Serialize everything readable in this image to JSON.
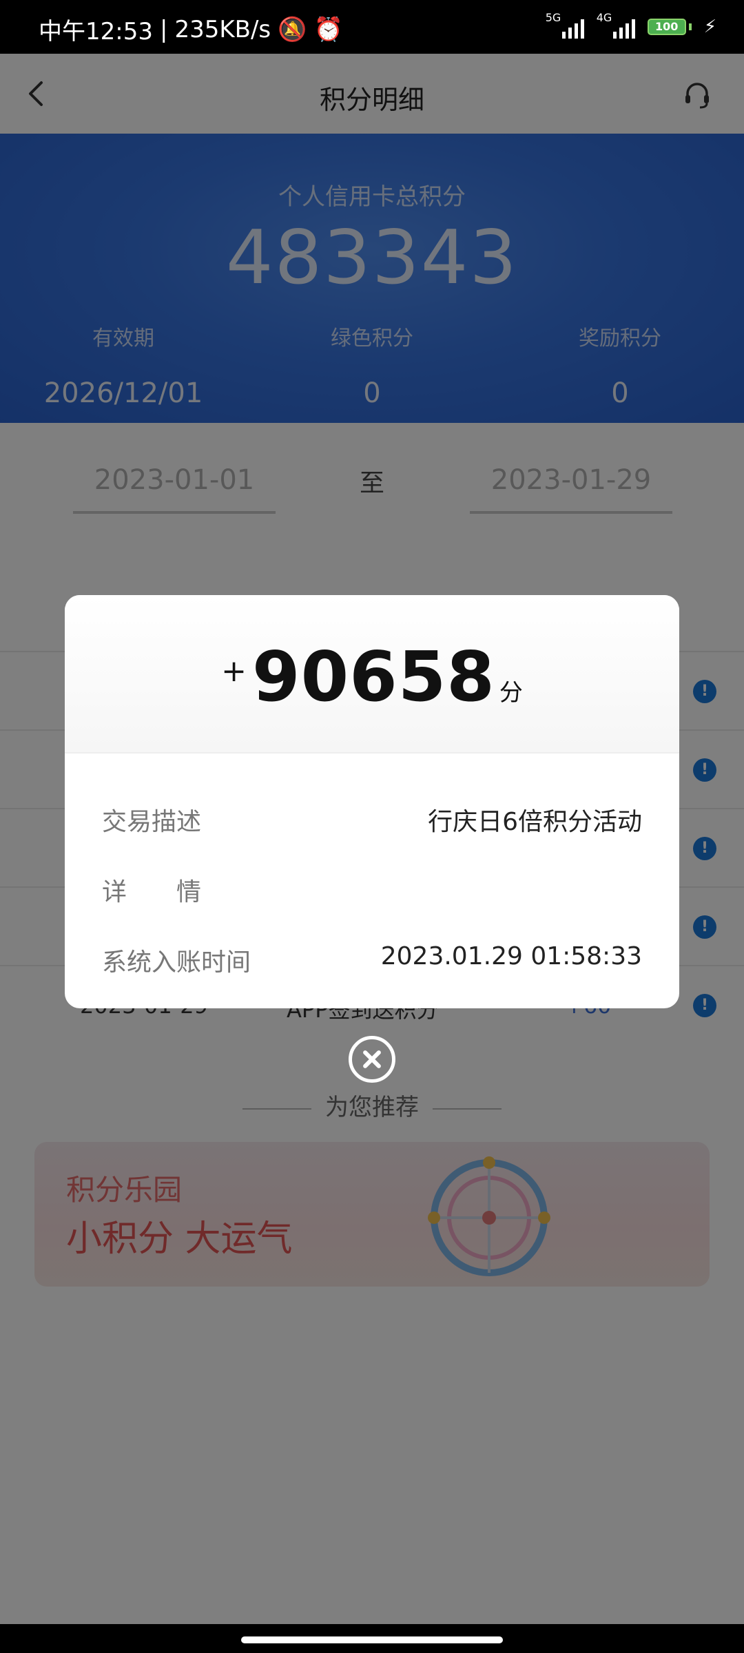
{
  "status_bar": {
    "time": "中午12:53",
    "speed": "235KB/s",
    "signal1_label": "5G",
    "signal2_label": "4G",
    "battery": "100"
  },
  "nav": {
    "title": "积分明细"
  },
  "points": {
    "label": "个人信用卡总积分",
    "total": "483343",
    "validity_label": "有效期",
    "validity_value": "2026/12/01",
    "green_label": "绿色积分",
    "green_value": "0",
    "reward_label": "奖励积分",
    "reward_value": "0"
  },
  "date_range": {
    "start": "2023-01-01",
    "separator": "至",
    "end": "2023-01-29"
  },
  "list": {
    "rows": [
      {
        "date": "",
        "desc": "",
        "points": ""
      },
      {
        "date": "",
        "desc": "",
        "points": ""
      },
      {
        "date": "",
        "desc": "",
        "points": ""
      },
      {
        "date": "",
        "desc": "",
        "points": ""
      },
      {
        "date": "2023-01-29",
        "desc": "APP签到送积分",
        "points": "+60"
      }
    ]
  },
  "recommend": {
    "title": "为您推荐",
    "banner_title": "积分乐园",
    "banner_slogan": "小积分 大运气"
  },
  "dialog": {
    "sign": "+",
    "amount": "90658",
    "unit": "分",
    "desc_label": "交易描述",
    "desc_value": "行庆日6倍积分活动",
    "detail_label": "详　　情",
    "detail_value": "",
    "time_label": "系统入账时间",
    "time_value": "2023.01.29 01:58:33"
  }
}
